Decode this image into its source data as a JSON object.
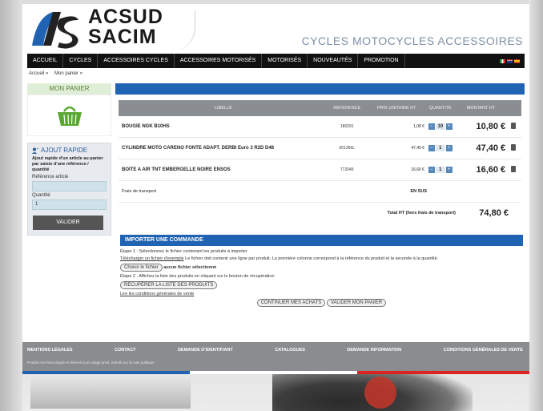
{
  "brand": {
    "line1": "ACSUD",
    "line2": "SACIM",
    "tagline": "CYCLES  MOTOCYCLES  ACCESSOIRES"
  },
  "nav": {
    "items": [
      "ACCUEIL",
      "CYCLES",
      "ACCESSOIRES CYCLES",
      "ACCESSOIRES MOTORISÉS",
      "MOTORISÉS",
      "NOUVEAUTÉS",
      "PROMOTION"
    ]
  },
  "breadcrumb": [
    "Accueil »",
    "Mon panier »"
  ],
  "sidebar": {
    "panier_title": "MON PANIER",
    "quick": {
      "title": "AJOUT RAPIDE",
      "desc": "Ajout rapide d'un article au panier par saisie d'une référence / quantité",
      "ref_label": "Référence article",
      "ref_value": "",
      "qty_label": "Quantité",
      "qty_value": "1",
      "submit": "VALIDER"
    }
  },
  "cart": {
    "headers": {
      "lib": "LIBELLÉ",
      "ref": "RÉFÉRENCE",
      "price": "PRIX UNITAIRE HT",
      "qty": "QUANTITÉ",
      "total": "MONTANT HT"
    },
    "rows": [
      {
        "lib": "BOUGIE NGK B10HS",
        "ref": "180291",
        "price": "1,08 €",
        "qty": "10",
        "total": "10,80 €"
      },
      {
        "lib": "CYLINDRE MOTO CARENO FONTE ADAPT. DERBI Euro 3 R2D D48",
        "ref": "001266L",
        "price": "47,40 €",
        "qty": "1",
        "total": "47,40 €"
      },
      {
        "lib": "BOITE A AIR TNT EMBERGELLE NOIRE ENSOS",
        "ref": "772045",
        "price": "16,60 €",
        "qty": "1",
        "total": "16,60 €"
      }
    ],
    "shipping_label": "Frais de transport",
    "shipping_value": "EN SUS",
    "total_label": "Total HT (hors frais de transport)",
    "total_value": "74,80 €"
  },
  "import": {
    "title": "IMPORTER UNE COMMANDE",
    "step1": "Étape 1 : Sélectionnez le fichier contenant les produits à importer",
    "example_link": "Télécharger un fichier d'exemple",
    "desc": "Le fichier doit contenir une ligne par produit. La première colonne correspond à la référence du produit et la seconde à la quantité.",
    "choose": "Choisir le fichier",
    "no_file": "aucun fichier sélectionné",
    "step2": "Étape 2 : Affichez la liste des produits en cliquant sur le bouton de récupération",
    "retrieve": "RÉCUPÉRER LA LISTE DES PRODUITS",
    "cgv_link": "Lire les conditions générales de vente",
    "continue": "CONTINUER MES ACHATS",
    "validate": "VALIDER MON PANIER"
  },
  "footer": {
    "links": [
      "MENTIONS LÉGALES",
      "CONTACT",
      "DEMANDE D'IDENTIFIANT",
      "CATALOGUES",
      "DEMANDE INFORMATION",
      "CONDITIONS GÉNÉRALES DE VENTE"
    ],
    "note": "Produit non-homologué et réservé à un usage privé, interdit sur la voie publique"
  },
  "colors": {
    "accent_blue": "#1f63b2",
    "nav": "#111111",
    "panier_green": "#dfeed6",
    "basket_green": "#5aa832",
    "footer_gray": "#8a8c90"
  },
  "icons": {
    "basket": "shopping-basket-icon",
    "quick_add": "user-add-icon",
    "delete": "trash-icon"
  }
}
